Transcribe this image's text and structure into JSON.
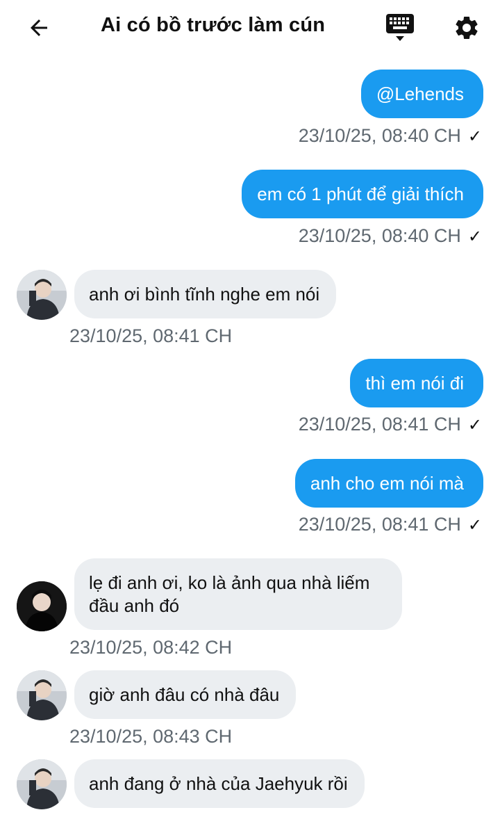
{
  "header": {
    "title": "Ai có bồ trước làm cún"
  },
  "colors": {
    "accent": "#1a9bf0",
    "incoming_bubble": "#ebeef1",
    "timestamp": "#5f6870"
  },
  "icons": {
    "back": "back-arrow-icon",
    "keyboard": "keyboard-icon",
    "settings": "gear-icon",
    "read": "check-icon"
  },
  "messages": [
    {
      "dir": "out",
      "text": "@Lehends",
      "time": "23/10/25, 08:40 CH",
      "read_mark": "✓"
    },
    {
      "dir": "out",
      "text": "em có 1 phút để giải thích",
      "time": "23/10/25, 08:40 CH",
      "read_mark": "✓"
    },
    {
      "dir": "in",
      "text": "anh ơi bình tĩnh nghe em nói",
      "time": "23/10/25, 08:41 CH",
      "avatar": "light"
    },
    {
      "dir": "out",
      "text": "thì em nói đi",
      "time": "23/10/25, 08:41 CH",
      "read_mark": "✓"
    },
    {
      "dir": "out",
      "text": "anh cho em nói mà",
      "time": "23/10/25, 08:41 CH",
      "read_mark": "✓"
    },
    {
      "dir": "in",
      "text": "lẹ đi anh ơi, ko là ảnh qua nhà liếm đầu anh đó",
      "time": "23/10/25, 08:42 CH",
      "avatar": "dark"
    },
    {
      "dir": "in",
      "text": "giờ anh đâu có nhà đâu",
      "time": "23/10/25, 08:43 CH",
      "avatar": "light"
    },
    {
      "dir": "in",
      "text": "anh đang ở nhà của Jaehyuk rồi",
      "time": "",
      "avatar": "light"
    }
  ]
}
